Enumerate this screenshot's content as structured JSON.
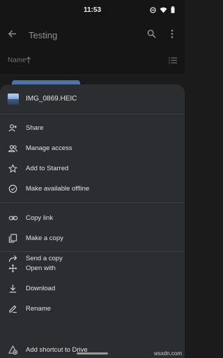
{
  "status": {
    "time": "11:53"
  },
  "appbar": {
    "title": "Testing"
  },
  "sort": {
    "label": "Name"
  },
  "file": {
    "name": "IMG_0869.HEIC"
  },
  "menu": {
    "share": "Share",
    "manage_access": "Manage access",
    "add_starred": "Add to Starred",
    "offline": "Make available offline",
    "copy_link": "Copy link",
    "make_copy": "Make a copy",
    "send_copy": "Send a copy",
    "open_with": "Open with",
    "download": "Download",
    "rename": "Rename",
    "add_shortcut": "Add shortcut to Drive"
  },
  "watermark": "wsxdn.com"
}
